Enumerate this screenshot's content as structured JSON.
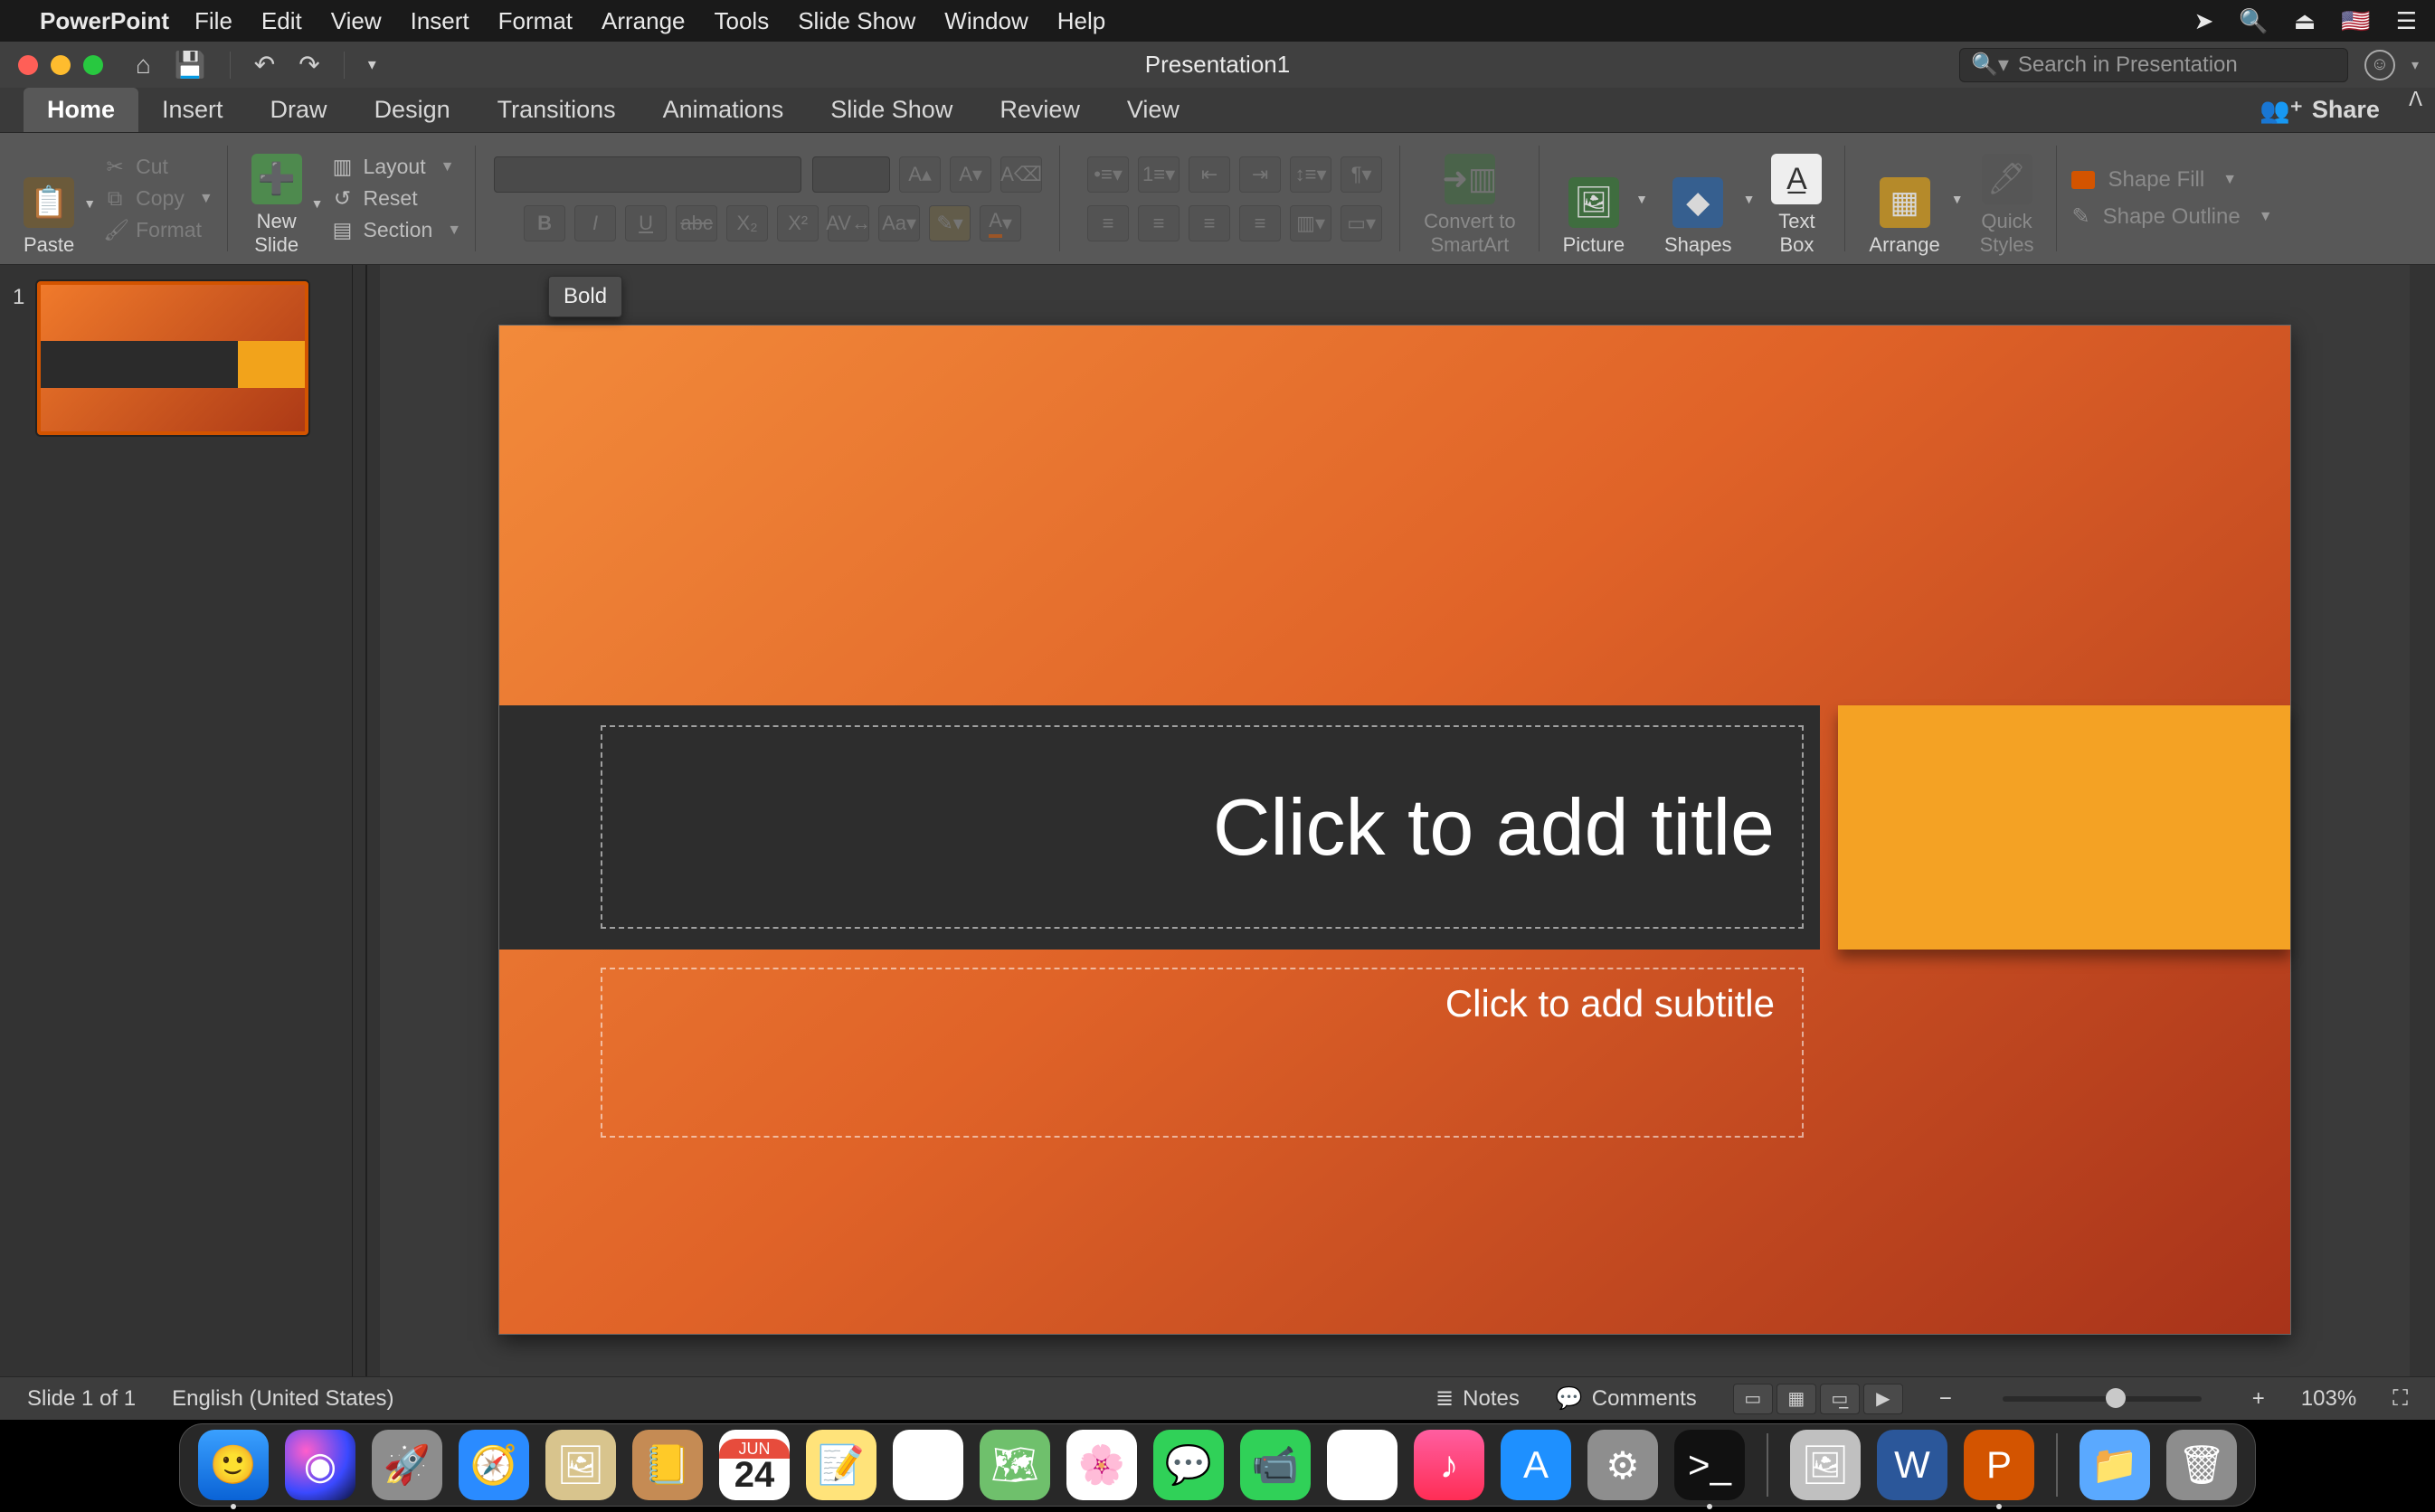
{
  "menubar": {
    "app": "PowerPoint",
    "items": [
      "File",
      "Edit",
      "View",
      "Insert",
      "Format",
      "Arrange",
      "Tools",
      "Slide Show",
      "Window",
      "Help"
    ]
  },
  "titlebar": {
    "doc": "Presentation1",
    "search_placeholder": "Search in Presentation"
  },
  "ribbon_tabs": [
    "Home",
    "Insert",
    "Draw",
    "Design",
    "Transitions",
    "Animations",
    "Slide Show",
    "Review",
    "View"
  ],
  "ribbon_tabs_active": "Home",
  "share_label": "Share",
  "ribbon": {
    "paste": "Paste",
    "cut": "Cut",
    "copy": "Copy",
    "format_painter": "Format",
    "new_slide": "New\nSlide",
    "layout": "Layout",
    "reset": "Reset",
    "section": "Section",
    "convert_sa": "Convert to\nSmartArt",
    "picture": "Picture",
    "shapes": "Shapes",
    "textbox": "Text\nBox",
    "arrange": "Arrange",
    "quick_styles": "Quick\nStyles",
    "shape_fill": "Shape Fill",
    "shape_outline": "Shape Outline"
  },
  "tooltip": "Bold",
  "thumbnail": {
    "number": "1"
  },
  "slide": {
    "title_placeholder": "Click to add title",
    "subtitle_placeholder": "Click to add subtitle"
  },
  "status": {
    "slide_of": "Slide 1 of 1",
    "lang": "English (United States)",
    "notes": "Notes",
    "comments": "Comments",
    "zoom": "103%"
  },
  "dock": {
    "cal_month": "JUN",
    "cal_day": "24"
  }
}
